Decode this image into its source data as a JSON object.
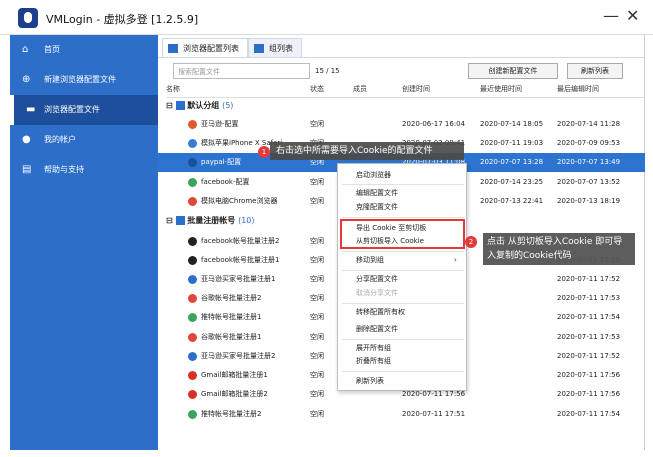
{
  "app": {
    "title": "VMLogin - 虚拟多登 [1.2.5.9]",
    "minimize": "—",
    "close": "✕"
  },
  "sidebar": {
    "items": [
      {
        "label": "首页",
        "icon": "home-icon"
      },
      {
        "label": "新建浏览器配置文件",
        "icon": "plus-circle-icon"
      },
      {
        "label": "浏览器配置文件",
        "icon": "folder-icon"
      },
      {
        "label": "我的帐户",
        "icon": "user-icon"
      },
      {
        "label": "帮助与支持",
        "icon": "book-icon"
      }
    ]
  },
  "tabs": [
    {
      "label": "浏览器配置列表"
    },
    {
      "label": "组列表"
    }
  ],
  "toolbar": {
    "search_placeholder": "搜索配置文件",
    "count": "15 / 15",
    "create_label": "创建新配置文件",
    "refresh_label": "刷新列表"
  },
  "table": {
    "headers": [
      "名称",
      "状态",
      "成员",
      "创建时间",
      "最近使用时间",
      "最后编辑时间"
    ],
    "groups": [
      {
        "name": "默认分组",
        "count": "(5)"
      },
      {
        "name": "批量注册帐号",
        "count": "(10)"
      }
    ],
    "rows": [
      {
        "name": "亚马逊-配置",
        "status": "空闲",
        "created": "2020-06-17 16:04",
        "used": "2020-07-14 18:05",
        "edited": "2020-07-14 11:28",
        "color": "#e05a2b"
      },
      {
        "name": "模拟苹果iPhone X Safari",
        "status": "空闲",
        "created": "2020-07-02 09:41",
        "used": "2020-07-11 19:03",
        "edited": "2020-07-09 09:53",
        "color": "#3a7bd5"
      },
      {
        "name": "paypal-配置",
        "status": "空闲",
        "created": "2020-07-03 11:08",
        "used": "2020-07-07 13:28",
        "edited": "2020-07-07 13:49",
        "color": "#1b4fa0"
      },
      {
        "name": "facebook-配置",
        "status": "空闲",
        "created": "",
        "used": "2020-07-14 23:25",
        "edited": "2020-07-07 13:52",
        "color": "#3ba55d"
      },
      {
        "name": "模拟电脑Chrome浏览器",
        "status": "空闲",
        "created": "",
        "used": "2020-07-13 22:41",
        "edited": "2020-07-13 18:19",
        "color": "#e0463b"
      },
      {
        "name": "facebook帐号批量注册2",
        "status": "空闲",
        "created": "",
        "used": "",
        "edited": "",
        "color": "#222"
      },
      {
        "name": "facebook帐号批量注册1",
        "status": "空闲",
        "created": "",
        "used": "",
        "edited": "2020-07-11 17:55",
        "color": "#222"
      },
      {
        "name": "亚马逊买家号批量注册1",
        "status": "空闲",
        "created": "",
        "used": "",
        "edited": "2020-07-11 17:52",
        "color": "#2d6ec9"
      },
      {
        "name": "谷歌帐号批量注册2",
        "status": "空闲",
        "created": "",
        "used": "",
        "edited": "2020-07-11 17:53",
        "color": "#e0463b"
      },
      {
        "name": "推特帐号批量注册1",
        "status": "空闲",
        "created": "",
        "used": "",
        "edited": "2020-07-11 17:54",
        "color": "#3ba55d"
      },
      {
        "name": "谷歌帐号批量注册1",
        "status": "空闲",
        "created": "",
        "used": "",
        "edited": "2020-07-11 17:53",
        "color": "#e0463b"
      },
      {
        "name": "亚马逊买家号批量注册2",
        "status": "空闲",
        "created": "",
        "used": "",
        "edited": "2020-07-11 17:52",
        "color": "#2d6ec9"
      },
      {
        "name": "Gmail邮箱批量注册1",
        "status": "空闲",
        "created": "",
        "used": "",
        "edited": "2020-07-11 17:56",
        "color": "#d93025"
      },
      {
        "name": "Gmail邮箱批量注册2",
        "status": "空闲",
        "created": "2020-07-11 17:56",
        "used": "",
        "edited": "2020-07-11 17:56",
        "color": "#d93025"
      },
      {
        "name": "推特帐号批量注册2",
        "status": "空闲",
        "created": "2020-07-11 17:51",
        "used": "",
        "edited": "2020-07-11 17:54",
        "color": "#3ba55d"
      }
    ]
  },
  "menu": {
    "items": [
      "启动浏览器",
      "编辑配置文件",
      "克隆配置文件",
      "导出 Cookie 至剪切板",
      "从剪切板导入 Cookie",
      "移动到组",
      "分享配置文件",
      "取消分享文件",
      "转移配置所有权",
      "删除配置文件",
      "展开所有组",
      "折叠所有组",
      "刷新列表"
    ],
    "submenu_arrow": "›"
  },
  "tips": {
    "tip1": "右击选中所需要导入Cookie的配置文件",
    "tip2": "点击 从剪切板导入Cookie 即可导入复制的Cookie代码",
    "badge1": "1",
    "badge2": "2"
  }
}
